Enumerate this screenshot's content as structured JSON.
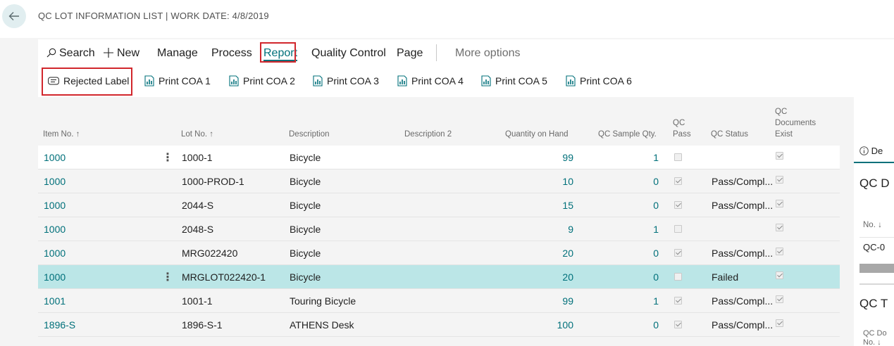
{
  "header": {
    "title": "QC LOT INFORMATION LIST | WORK DATE: 4/8/2019"
  },
  "actionbar": {
    "menu": {
      "search": "Search",
      "new": "New",
      "manage": "Manage",
      "process": "Process",
      "report": "Report",
      "quality_control": "Quality Control",
      "page": "Page",
      "more": "More options"
    },
    "report_actions": [
      "Rejected Label",
      "Print COA 1",
      "Print COA 2",
      "Print COA 3",
      "Print COA 4",
      "Print COA 5",
      "Print COA 6"
    ]
  },
  "table": {
    "columns": {
      "item_no": "Item No. ↑",
      "lot_no": "Lot No. ↑",
      "description": "Description",
      "description2": "Description 2",
      "qty_on_hand": "Quantity on Hand",
      "qc_sample_qty": "QC Sample Qty.",
      "qc_pass_1": "QC",
      "qc_pass_2": "Pass",
      "qc_status": "QC Status",
      "qc_docs_1": "QC",
      "qc_docs_2": "Documents",
      "qc_docs_3": "Exist"
    },
    "rows": [
      {
        "item": "1000",
        "lot": "1000-1",
        "desc": "Bicycle",
        "desc2": "",
        "qty": "99",
        "sample": "1",
        "pass": false,
        "status": "",
        "docs": true
      },
      {
        "item": "1000",
        "lot": "1000-PROD-1",
        "desc": "Bicycle",
        "desc2": "",
        "qty": "10",
        "sample": "0",
        "pass": true,
        "status": "Pass/Compl...",
        "docs": true
      },
      {
        "item": "1000",
        "lot": "2044-S",
        "desc": "Bicycle",
        "desc2": "",
        "qty": "15",
        "sample": "0",
        "pass": true,
        "status": "Pass/Compl...",
        "docs": true
      },
      {
        "item": "1000",
        "lot": "2048-S",
        "desc": "Bicycle",
        "desc2": "",
        "qty": "9",
        "sample": "1",
        "pass": false,
        "status": "",
        "docs": true
      },
      {
        "item": "1000",
        "lot": "MRG022420",
        "desc": "Bicycle",
        "desc2": "",
        "qty": "20",
        "sample": "0",
        "pass": true,
        "status": "Pass/Compl...",
        "docs": true
      },
      {
        "item": "1000",
        "lot": "MRGLOT022420-1",
        "desc": "Bicycle",
        "desc2": "",
        "qty": "20",
        "sample": "0",
        "pass": false,
        "status": "Failed",
        "docs": true
      },
      {
        "item": "1001",
        "lot": "1001-1",
        "desc": "Touring Bicycle",
        "desc2": "",
        "qty": "99",
        "sample": "1",
        "pass": true,
        "status": "Pass/Compl...",
        "docs": true
      },
      {
        "item": "1896-S",
        "lot": "1896-S-1",
        "desc": "ATHENS Desk",
        "desc2": "",
        "qty": "100",
        "sample": "0",
        "pass": true,
        "status": "Pass/Compl...",
        "docs": true
      }
    ]
  },
  "factbox": {
    "details_tab": "De",
    "section1_title": "QC D",
    "no_header": "No. ↓",
    "first_value": "QC-0",
    "section2_title": "QC T",
    "bottom_label_1": "QC Do",
    "bottom_label_2": "No. ↓"
  },
  "colors": {
    "accent": "#00707a",
    "selected_row": "#bbe6e7",
    "highlight_box": "#d1262c",
    "background": "#f4f4f4"
  }
}
